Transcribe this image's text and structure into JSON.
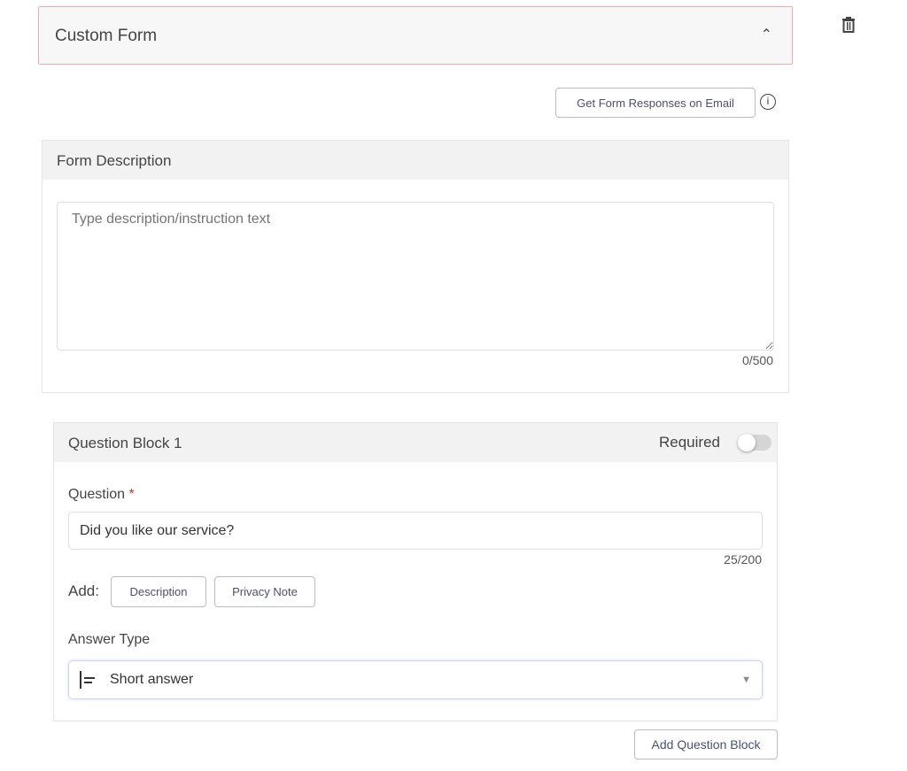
{
  "header": {
    "title": "Custom Form",
    "collapse_icon": "chevron-up-icon"
  },
  "delete_icon": "trash-icon",
  "email_button": "Get Form Responses on Email",
  "info_icon": "info-icon",
  "description": {
    "title": "Form Description",
    "placeholder": "Type description/instruction text",
    "value": "",
    "counter": "0/500"
  },
  "question_block": {
    "title": "Question Block 1",
    "required_label": "Required",
    "required": false,
    "question_label": "Question",
    "required_mark": "*",
    "question_value": "Did you like our service?",
    "question_counter": "25/200",
    "add_label": "Add:",
    "add_buttons": [
      "Description",
      "Privacy Note"
    ],
    "answer_type_label": "Answer Type",
    "answer_type_value": "Short answer",
    "answer_type_icon": "short-answer-icon"
  },
  "add_question_button": "Add Question Block"
}
